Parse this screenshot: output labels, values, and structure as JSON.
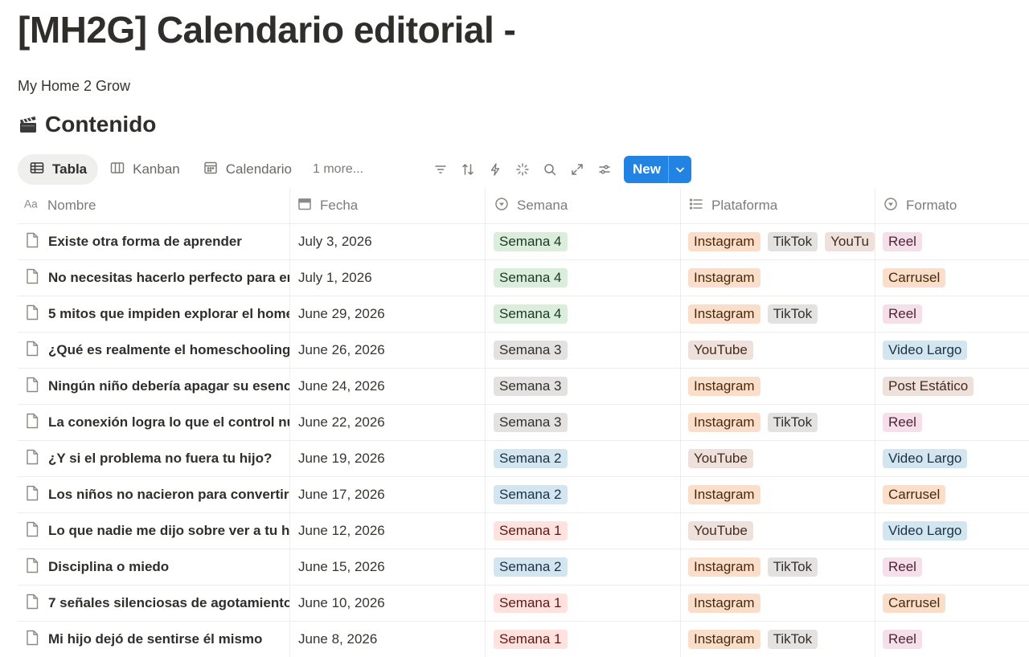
{
  "page": {
    "title": "[MH2G] Calendario editorial -",
    "subtitle": "My Home 2 Grow"
  },
  "database": {
    "icon": "clapperboard-icon",
    "title": "Contenido"
  },
  "views": [
    {
      "label": "Tabla",
      "icon": "table-icon",
      "active": true
    },
    {
      "label": "Kanban",
      "icon": "board-icon",
      "active": false
    },
    {
      "label": "Calendario",
      "icon": "calendar-icon",
      "active": false
    }
  ],
  "more_views": "1 more...",
  "new_button": {
    "label": "New"
  },
  "columns": [
    {
      "label": "Nombre",
      "icon": "text-property-icon"
    },
    {
      "label": "Fecha",
      "icon": "calendar-property-icon"
    },
    {
      "label": "Semana",
      "icon": "select-property-icon"
    },
    {
      "label": "Plataforma",
      "icon": "multiselect-property-icon"
    },
    {
      "label": "Formato",
      "icon": "select-property-icon"
    }
  ],
  "rows": [
    {
      "nombre": "Existe otra forma de aprender",
      "fecha": "July 3, 2026",
      "semana": {
        "label": "Semana 4",
        "color": "green"
      },
      "plataforma": [
        {
          "label": "Instagram",
          "color": "orange"
        },
        {
          "label": "TikTok",
          "color": "gray"
        },
        {
          "label": "YouTu",
          "color": "brown"
        }
      ],
      "formato": {
        "label": "Reel",
        "color": "pink"
      }
    },
    {
      "nombre": "No necesitas hacerlo perfecto para er",
      "fecha": "July 1, 2026",
      "semana": {
        "label": "Semana 4",
        "color": "green"
      },
      "plataforma": [
        {
          "label": "Instagram",
          "color": "orange"
        }
      ],
      "formato": {
        "label": "Carrusel",
        "color": "orange"
      }
    },
    {
      "nombre": "5 mitos que impiden explorar el home",
      "fecha": "June 29, 2026",
      "semana": {
        "label": "Semana 4",
        "color": "green"
      },
      "plataforma": [
        {
          "label": "Instagram",
          "color": "orange"
        },
        {
          "label": "TikTok",
          "color": "gray"
        }
      ],
      "formato": {
        "label": "Reel",
        "color": "pink"
      }
    },
    {
      "nombre": "¿Qué es realmente el homeschooling?",
      "fecha": "June 26, 2026",
      "semana": {
        "label": "Semana 3",
        "color": "gray"
      },
      "plataforma": [
        {
          "label": "YouTube",
          "color": "brown"
        }
      ],
      "formato": {
        "label": "Video Largo",
        "color": "blue"
      }
    },
    {
      "nombre": "Ningún niño debería apagar su esenci",
      "fecha": "June 24, 2026",
      "semana": {
        "label": "Semana 3",
        "color": "gray"
      },
      "plataforma": [
        {
          "label": "Instagram",
          "color": "orange"
        }
      ],
      "formato": {
        "label": "Post Estático",
        "color": "brown"
      }
    },
    {
      "nombre": "La conexión logra lo que el control nui",
      "fecha": "June 22, 2026",
      "semana": {
        "label": "Semana 3",
        "color": "gray"
      },
      "plataforma": [
        {
          "label": "Instagram",
          "color": "orange"
        },
        {
          "label": "TikTok",
          "color": "gray"
        }
      ],
      "formato": {
        "label": "Reel",
        "color": "pink"
      }
    },
    {
      "nombre": "¿Y si el problema no fuera tu hijo?",
      "fecha": "June 19, 2026",
      "semana": {
        "label": "Semana 2",
        "color": "blue"
      },
      "plataforma": [
        {
          "label": "YouTube",
          "color": "brown"
        }
      ],
      "formato": {
        "label": "Video Largo",
        "color": "blue"
      }
    },
    {
      "nombre": "Los niños no nacieron para convertirs",
      "fecha": "June 17, 2026",
      "semana": {
        "label": "Semana 2",
        "color": "blue"
      },
      "plataforma": [
        {
          "label": "Instagram",
          "color": "orange"
        }
      ],
      "formato": {
        "label": "Carrusel",
        "color": "orange"
      }
    },
    {
      "nombre": "Lo que nadie me dijo sobre ver a tu hij",
      "fecha": "June 12, 2026",
      "semana": {
        "label": "Semana 1",
        "color": "red"
      },
      "plataforma": [
        {
          "label": "YouTube",
          "color": "brown"
        }
      ],
      "formato": {
        "label": "Video Largo",
        "color": "blue"
      }
    },
    {
      "nombre": "Disciplina o miedo",
      "fecha": "June 15, 2026",
      "semana": {
        "label": "Semana 2",
        "color": "blue"
      },
      "plataforma": [
        {
          "label": "Instagram",
          "color": "orange"
        },
        {
          "label": "TikTok",
          "color": "gray"
        }
      ],
      "formato": {
        "label": "Reel",
        "color": "pink"
      }
    },
    {
      "nombre": "7 señales silenciosas de agotamiento",
      "fecha": "June 10, 2026",
      "semana": {
        "label": "Semana 1",
        "color": "red"
      },
      "plataforma": [
        {
          "label": "Instagram",
          "color": "orange"
        }
      ],
      "formato": {
        "label": "Carrusel",
        "color": "orange"
      }
    },
    {
      "nombre": "Mi hijo dejó de sentirse él mismo",
      "fecha": "June 8, 2026",
      "semana": {
        "label": "Semana 1",
        "color": "red"
      },
      "plataforma": [
        {
          "label": "Instagram",
          "color": "orange"
        },
        {
          "label": "TikTok",
          "color": "gray"
        }
      ],
      "formato": {
        "label": "Reel",
        "color": "pink"
      }
    }
  ],
  "colors": {
    "accent": "#2383e2",
    "tag_green": "#dbeddb",
    "tag_gray": "#e3e2e0",
    "tag_blue": "#d3e5ef",
    "tag_red": "#ffe2dd",
    "tag_orange": "#fadec9",
    "tag_pink": "#f5e0e9",
    "tag_brown": "#eee0da"
  }
}
